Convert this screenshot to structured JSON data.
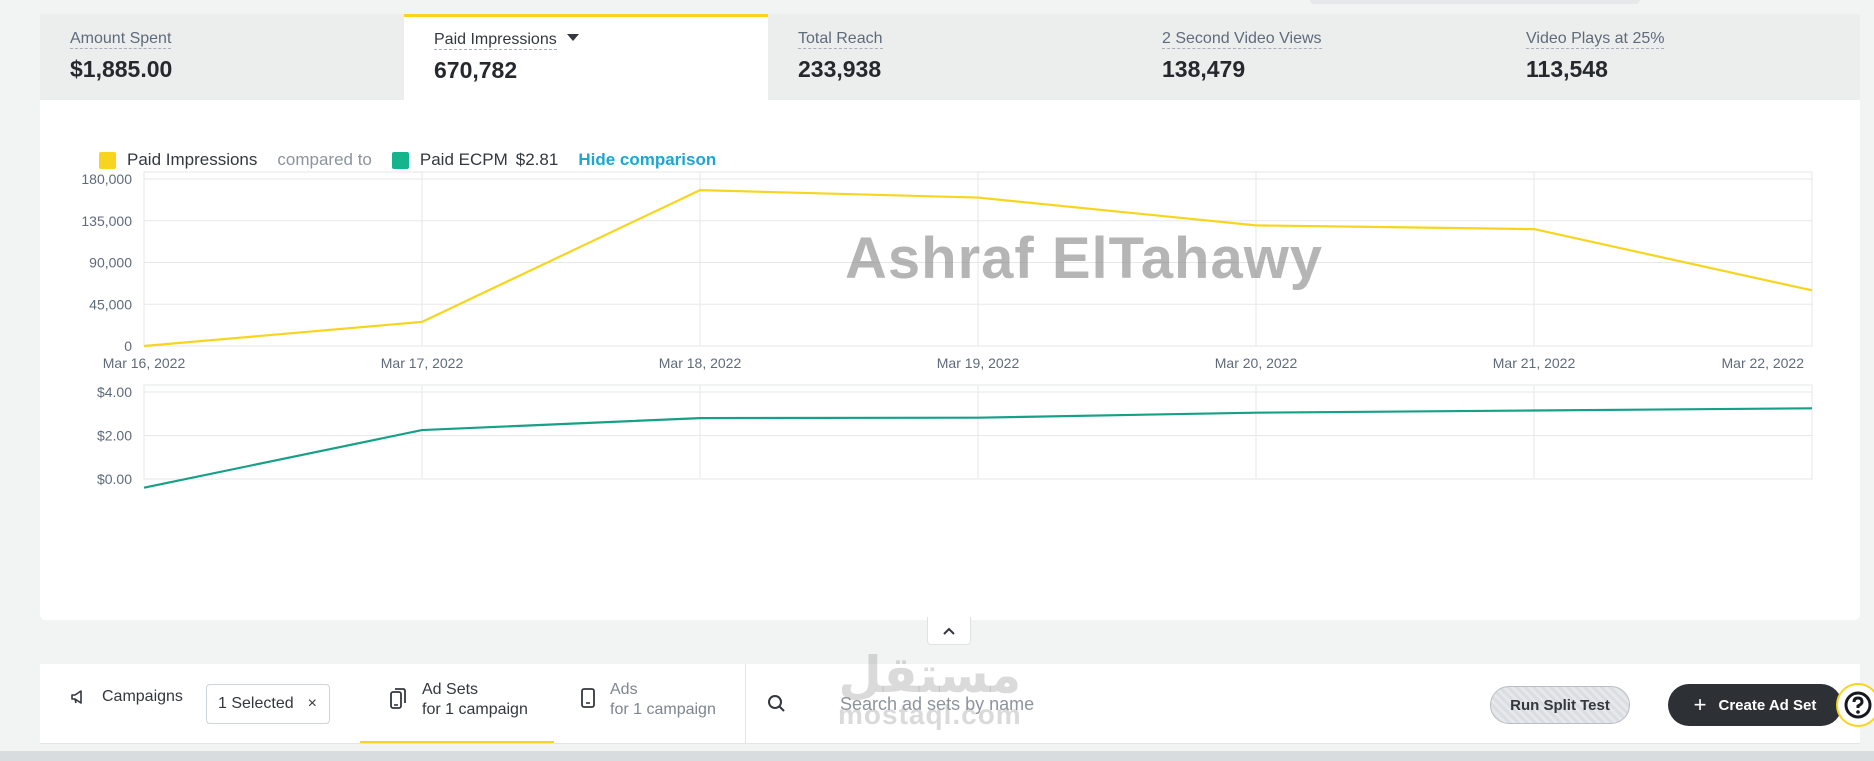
{
  "metrics": [
    {
      "label": "Amount Spent",
      "value": "$1,885.00"
    },
    {
      "label": "Paid Impressions",
      "value": "670,782"
    },
    {
      "label": "Total Reach",
      "value": "233,938"
    },
    {
      "label": "2 Second Video Views",
      "value": "138,479"
    },
    {
      "label": "Video Plays at 25%",
      "value": "113,548"
    }
  ],
  "active_metric": "Paid Impressions",
  "legend": {
    "primary_label": "Paid Impressions",
    "compared_to": "compared to",
    "secondary_label": "Paid ECPM",
    "secondary_value": "$2.81",
    "hide_comparison": "Hide comparison"
  },
  "colors": {
    "primary": "#f7d51e",
    "secondary": "#16a085",
    "accent_link": "#1ea6d1"
  },
  "chart_data": [
    {
      "type": "line",
      "x": [
        "Mar 16, 2022",
        "Mar 17, 2022",
        "Mar 18, 2022",
        "Mar 19, 2022",
        "Mar 20, 2022",
        "Mar 21, 2022",
        "Mar 22, 2022"
      ],
      "series": [
        {
          "name": "Paid Impressions",
          "values": [
            0,
            26000,
            168000,
            160000,
            130000,
            126000,
            60000
          ]
        }
      ],
      "yticks": [
        "0",
        "45,000",
        "90,000",
        "135,000",
        "180,000"
      ],
      "ylim": [
        0,
        180000
      ],
      "grid": true
    },
    {
      "type": "line",
      "x": [
        "Mar 16, 2022",
        "Mar 17, 2022",
        "Mar 18, 2022",
        "Mar 19, 2022",
        "Mar 20, 2022",
        "Mar 21, 2022",
        "Mar 22, 2022"
      ],
      "series": [
        {
          "name": "Paid ECPM",
          "values": [
            -0.4,
            2.25,
            2.8,
            2.82,
            3.05,
            3.15,
            3.25
          ]
        }
      ],
      "yticks": [
        "$0.00",
        "$2.00",
        "$4.00"
      ],
      "ylim": [
        0,
        4
      ],
      "grid": true
    }
  ],
  "watermark": "Ashraf ElTahawy",
  "bottom": {
    "campaigns_label": "Campaigns",
    "selected_label": "1 Selected",
    "selected_close": "×",
    "adsets_label": "Ad Sets",
    "adsets_sub": "for 1 campaign",
    "ads_label": "Ads",
    "ads_sub": "for 1 campaign",
    "search_placeholder": "Search ad sets by name",
    "split_test_label": "Run Split Test",
    "create_label": "Create Ad Set",
    "create_plus": "+",
    "mostaql_ar": "مستقل",
    "mostaql_en": "mostaql.com"
  },
  "collapse_icon": "chevron-up-icon"
}
